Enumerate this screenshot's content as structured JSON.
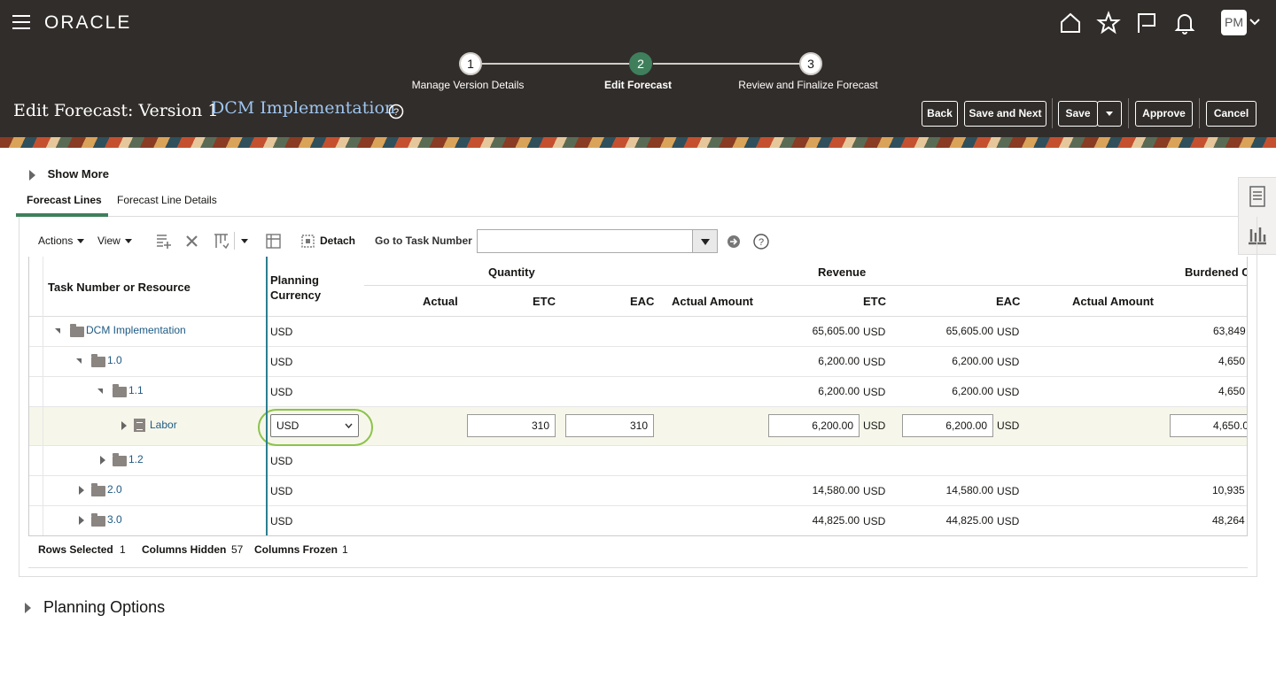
{
  "header": {
    "brand": "ORACLE",
    "avatar_initials": "PM",
    "train": [
      {
        "num": "1",
        "label": "Manage Version Details"
      },
      {
        "num": "2",
        "label": "Edit Forecast"
      },
      {
        "num": "3",
        "label": "Review and Finalize Forecast"
      }
    ],
    "page_title": "Edit Forecast: Version 1",
    "project_name": "DCM Implementation",
    "buttons": {
      "back": "Back",
      "save_next": "Save and Next",
      "save": "Save",
      "approve": "Approve",
      "cancel": "Cancel"
    }
  },
  "show_more": "Show More",
  "tabs": [
    "Forecast Lines",
    "Forecast Line Details"
  ],
  "toolbar": {
    "actions": "Actions",
    "view": "View",
    "detach": "Detach",
    "go_to_task": "Go to Task Number",
    "go_to_task_value": ""
  },
  "grid": {
    "headers": {
      "task": "Task Number or Resource",
      "planning_currency": "Planning Currency",
      "quantity": "Quantity",
      "revenue": "Revenue",
      "burdened": "Burdened C",
      "actual": "Actual",
      "etc": "ETC",
      "eac": "EAC",
      "actual_amount": "Actual Amount",
      "rev_etc": "ETC",
      "rev_eac": "EAC",
      "actual_amount2": "Actual Amount"
    },
    "rows": [
      {
        "name": "DCM Implementation",
        "currency": "USD",
        "rev_etc": "65,605.00",
        "rev_etc_cur": "USD",
        "rev_eac": "65,605.00",
        "rev_eac_cur": "USD",
        "burdened": "63,849"
      },
      {
        "name": "1.0",
        "currency": "USD",
        "rev_etc": "6,200.00",
        "rev_etc_cur": "USD",
        "rev_eac": "6,200.00",
        "rev_eac_cur": "USD",
        "burdened": "4,650"
      },
      {
        "name": "1.1",
        "currency": "USD",
        "rev_etc": "6,200.00",
        "rev_etc_cur": "USD",
        "rev_eac": "6,200.00",
        "rev_eac_cur": "USD",
        "burdened": "4,650"
      },
      {
        "name": "Labor",
        "currency": "USD",
        "qty_etc": "310",
        "qty_eac": "310",
        "rev_etc": "6,200.00",
        "rev_etc_cur": "USD",
        "rev_eac": "6,200.00",
        "rev_eac_cur": "USD",
        "burdened": "4,650.0"
      },
      {
        "name": "1.2",
        "currency": "USD"
      },
      {
        "name": "2.0",
        "currency": "USD",
        "rev_etc": "14,580.00",
        "rev_etc_cur": "USD",
        "rev_eac": "14,580.00",
        "rev_eac_cur": "USD",
        "burdened": "10,935"
      },
      {
        "name": "3.0",
        "currency": "USD",
        "rev_etc": "44,825.00",
        "rev_etc_cur": "USD",
        "rev_eac": "44,825.00",
        "rev_eac_cur": "USD",
        "burdened": "48,264"
      }
    ]
  },
  "footer": {
    "rows_selected_label": "Rows Selected",
    "rows_selected": "1",
    "columns_hidden_label": "Columns Hidden",
    "columns_hidden": "57",
    "columns_frozen_label": "Columns Frozen",
    "columns_frozen": "1"
  },
  "planning_options": "Planning Options",
  "colors": {
    "header_bg": "#312d2a",
    "accent_green": "#3f7f5c",
    "link": "#1e5a84",
    "freeze_line": "#2b7e8f"
  }
}
